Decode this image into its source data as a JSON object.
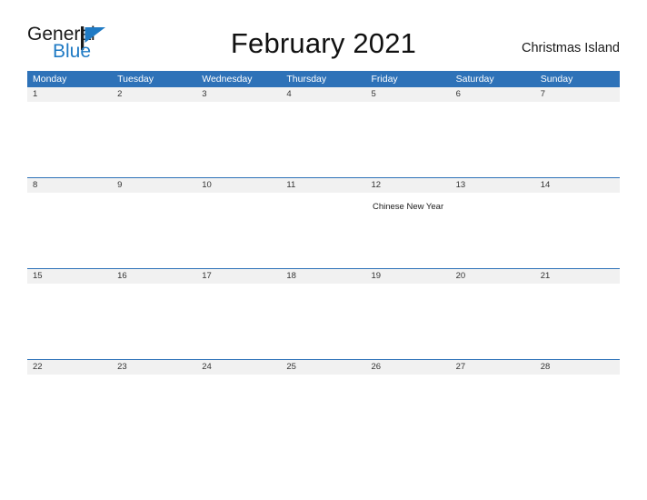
{
  "brand": {
    "name_part1": "General",
    "name_part2": "Blue",
    "mark": "triangle-flag-icon",
    "color_dark": "#1a1a1a",
    "color_blue": "#1f7ac4"
  },
  "header": {
    "title": "February 2021",
    "location": "Christmas Island",
    "accent_color": "#2E72B8",
    "date_band_color": "#f1f1f1"
  },
  "weekdays": [
    "Monday",
    "Tuesday",
    "Wednesday",
    "Thursday",
    "Friday",
    "Saturday",
    "Sunday"
  ],
  "weeks": [
    {
      "days": [
        {
          "date": "1",
          "event": ""
        },
        {
          "date": "2",
          "event": ""
        },
        {
          "date": "3",
          "event": ""
        },
        {
          "date": "4",
          "event": ""
        },
        {
          "date": "5",
          "event": ""
        },
        {
          "date": "6",
          "event": ""
        },
        {
          "date": "7",
          "event": ""
        }
      ]
    },
    {
      "days": [
        {
          "date": "8",
          "event": ""
        },
        {
          "date": "9",
          "event": ""
        },
        {
          "date": "10",
          "event": ""
        },
        {
          "date": "11",
          "event": ""
        },
        {
          "date": "12",
          "event": "Chinese New Year"
        },
        {
          "date": "13",
          "event": ""
        },
        {
          "date": "14",
          "event": ""
        }
      ]
    },
    {
      "days": [
        {
          "date": "15",
          "event": ""
        },
        {
          "date": "16",
          "event": ""
        },
        {
          "date": "17",
          "event": ""
        },
        {
          "date": "18",
          "event": ""
        },
        {
          "date": "19",
          "event": ""
        },
        {
          "date": "20",
          "event": ""
        },
        {
          "date": "21",
          "event": ""
        }
      ]
    },
    {
      "days": [
        {
          "date": "22",
          "event": ""
        },
        {
          "date": "23",
          "event": ""
        },
        {
          "date": "24",
          "event": ""
        },
        {
          "date": "25",
          "event": ""
        },
        {
          "date": "26",
          "event": ""
        },
        {
          "date": "27",
          "event": ""
        },
        {
          "date": "28",
          "event": ""
        }
      ]
    }
  ]
}
